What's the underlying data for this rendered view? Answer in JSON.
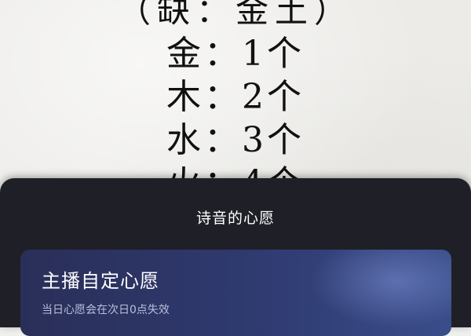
{
  "background_text": {
    "lines": [
      "（缺：金土）",
      "金：1个",
      "木：2个",
      "水：3个",
      "火：4个"
    ]
  },
  "sheet": {
    "title": "诗音的心愿",
    "card": {
      "title": "主播自定心愿",
      "subtitle": "当日心愿会在次日0点失效"
    }
  },
  "colors": {
    "sheet_bg": "#1f2027",
    "card_gradient_start": "#2a2f58",
    "card_gradient_end": "#3a4d8a",
    "paper_bg": "#ecebe8"
  }
}
